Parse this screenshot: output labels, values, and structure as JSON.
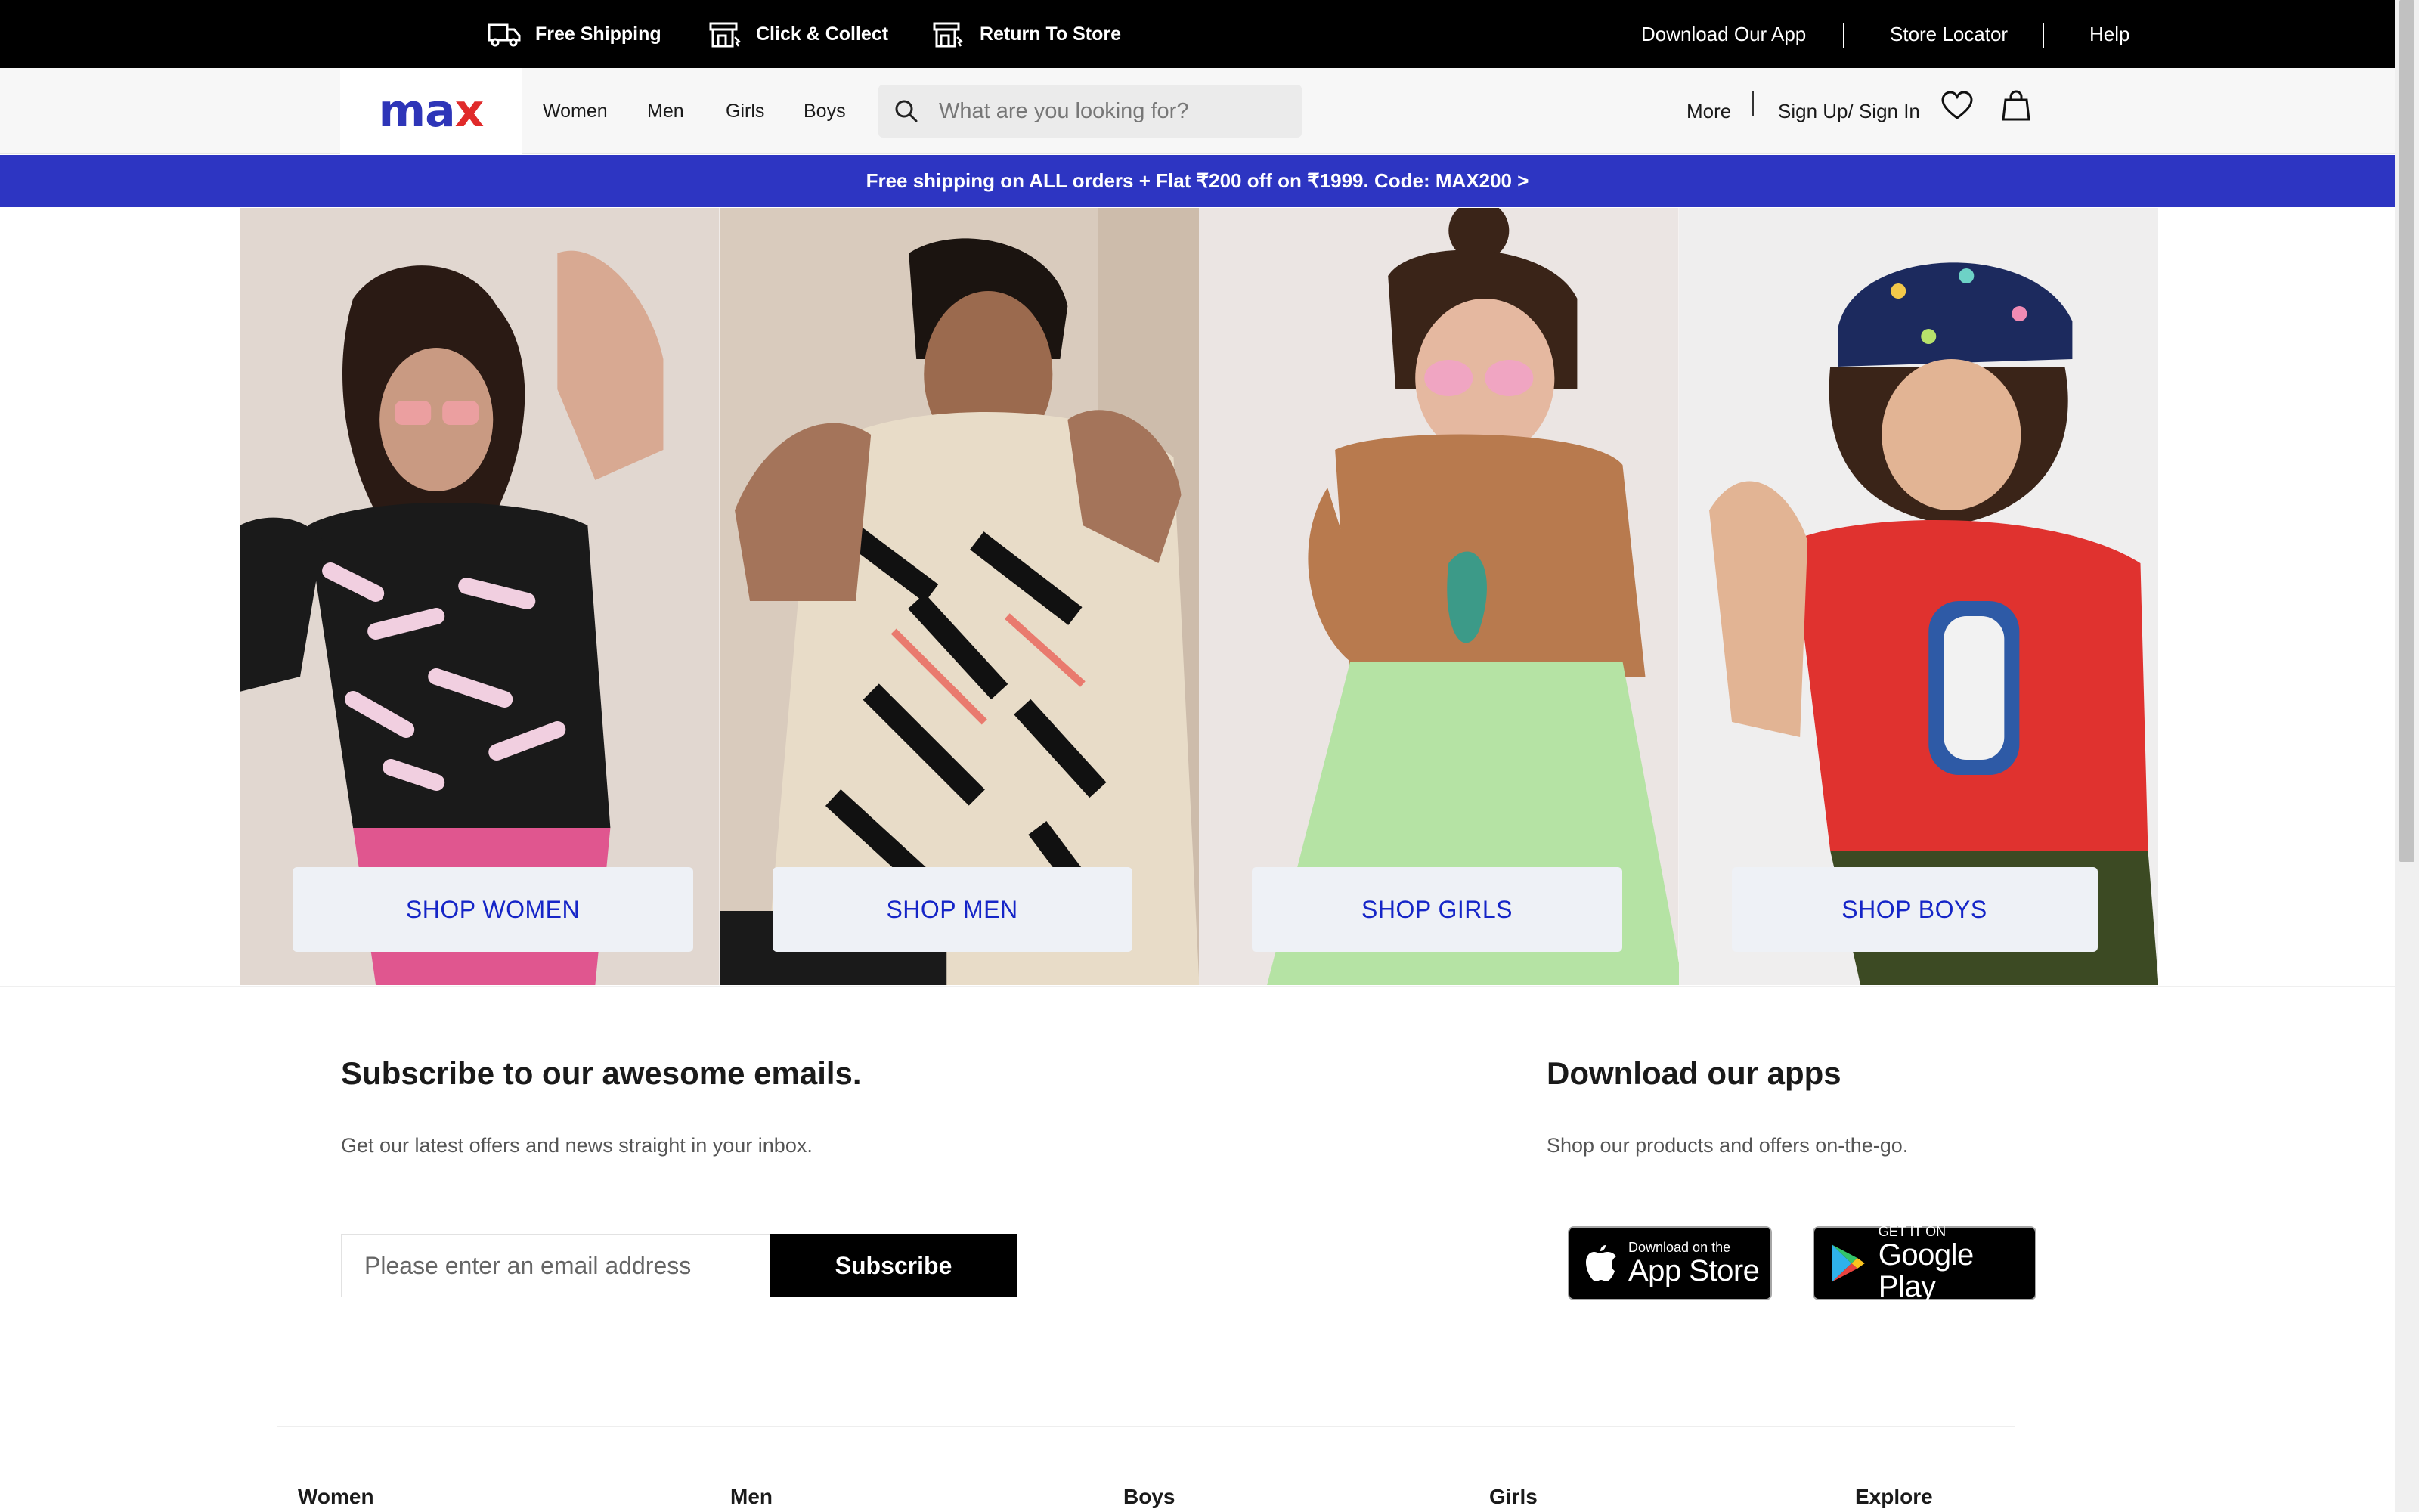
{
  "topbar": {
    "free_shipping": "Free Shipping",
    "click_collect": "Click & Collect",
    "return_store": "Return To Store",
    "download_app": "Download Our App",
    "store_locator": "Store Locator",
    "help": "Help"
  },
  "header": {
    "logo_m": "ma",
    "logo_x": "x",
    "nav": [
      "Women",
      "Men",
      "Girls",
      "Boys"
    ],
    "search_placeholder": "What are you looking for?",
    "more": "More",
    "signin": "Sign Up/ Sign In"
  },
  "banner": {
    "text": "Free shipping on ALL orders + Flat ₹200 off on ₹1999. Code: MAX200 >"
  },
  "tiles": [
    {
      "label": "SHOP WOMEN"
    },
    {
      "label": "SHOP MEN"
    },
    {
      "label": "SHOP GIRLS"
    },
    {
      "label": "SHOP BOYS"
    }
  ],
  "subscribe": {
    "title": "Subscribe to our awesome emails.",
    "desc": "Get our latest offers and news straight in your inbox.",
    "email_placeholder": "Please enter an email address",
    "button": "Subscribe"
  },
  "apps": {
    "title": "Download our apps",
    "desc": "Shop our products and offers on-the-go.",
    "appstore_small": "Download on the",
    "appstore_big": "App Store",
    "gplay_small": "GET IT ON",
    "gplay_big": "Google Play"
  },
  "footer": {
    "columns": [
      "Women",
      "Men",
      "Boys",
      "Girls",
      "Explore"
    ]
  },
  "colors": {
    "brand_blue": "#2d35c2",
    "brand_red": "#e02a2a",
    "shop_text": "#1525c7"
  }
}
